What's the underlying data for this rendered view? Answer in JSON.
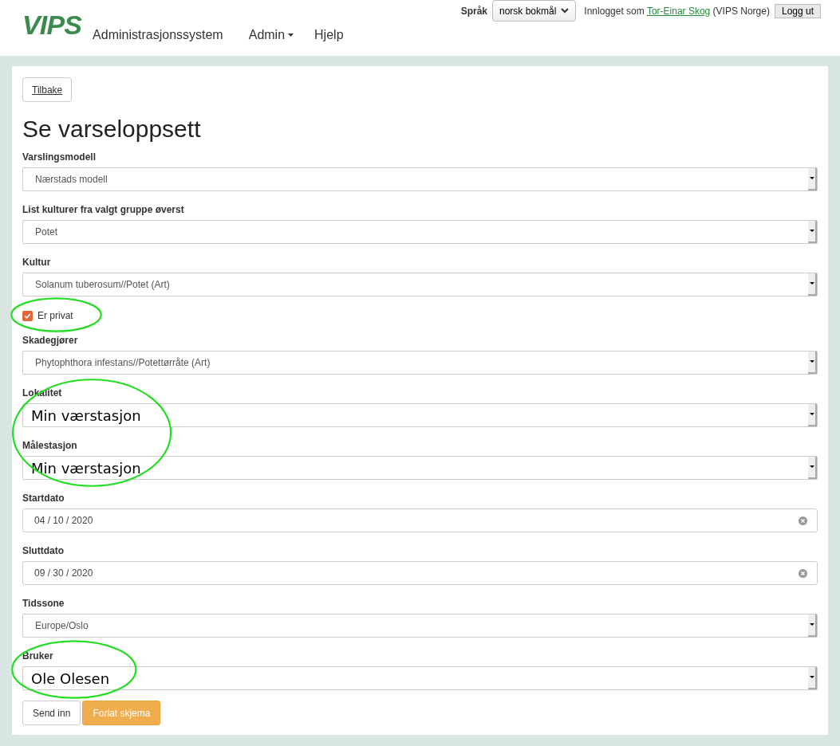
{
  "header": {
    "logo": "VIPS",
    "app_title": "Administrasjonssystem",
    "nav": [
      {
        "label": "Admin",
        "dropdown": true
      },
      {
        "label": "Hjelp",
        "dropdown": false
      }
    ],
    "language_label": "Språk",
    "language_value": "norsk bokmål",
    "logged_in_text": "Innlogget som",
    "user_link": "Tor-Einar Skog",
    "organization": "(VIPS Norge)",
    "logout": "Logg ut"
  },
  "back_button": "Tilbake",
  "title": "Se varseloppsett",
  "groups": [
    {
      "circled": false,
      "fields": [
        {
          "kind": "select",
          "label": "Varslingsmodell",
          "value": "Nærstads modell",
          "large": false
        },
        {
          "kind": "select",
          "label": "List kulturer fra valgt gruppe øverst",
          "value": "Potet",
          "large": false
        },
        {
          "kind": "select",
          "label": "Kultur",
          "value": "Solanum tuberosum//Potet (Art)",
          "large": false
        }
      ]
    },
    {
      "circled": true,
      "fields": [
        {
          "kind": "checkbox",
          "label": "Er privat",
          "checked": true
        }
      ]
    },
    {
      "circled": false,
      "fields": [
        {
          "kind": "select",
          "label": "Skadegjører",
          "value": "Phytophthora infestans//Potettørråte (Art)",
          "large": false
        }
      ]
    },
    {
      "circled": true,
      "fields": [
        {
          "kind": "select",
          "label": "Lokalitet",
          "value": "Min værstasjon",
          "large": true
        },
        {
          "kind": "select",
          "label": "Målestasjon",
          "value": "Min værstasjon",
          "large": true
        }
      ]
    },
    {
      "circled": false,
      "fields": [
        {
          "kind": "date",
          "label": "Startdato",
          "value": "04 / 10 / 2020"
        },
        {
          "kind": "date",
          "label": "Sluttdato",
          "value": "09 / 30 / 2020"
        },
        {
          "kind": "select",
          "label": "Tidssone",
          "value": "Europe/Oslo",
          "large": false
        }
      ]
    },
    {
      "circled": true,
      "fields": [
        {
          "kind": "select",
          "label": "Bruker",
          "value": "Ole Olesen",
          "large": true
        }
      ]
    }
  ],
  "buttons": [
    {
      "label": "Send inn",
      "primary": false
    },
    {
      "label": "Forlat skjema",
      "primary": true
    }
  ]
}
